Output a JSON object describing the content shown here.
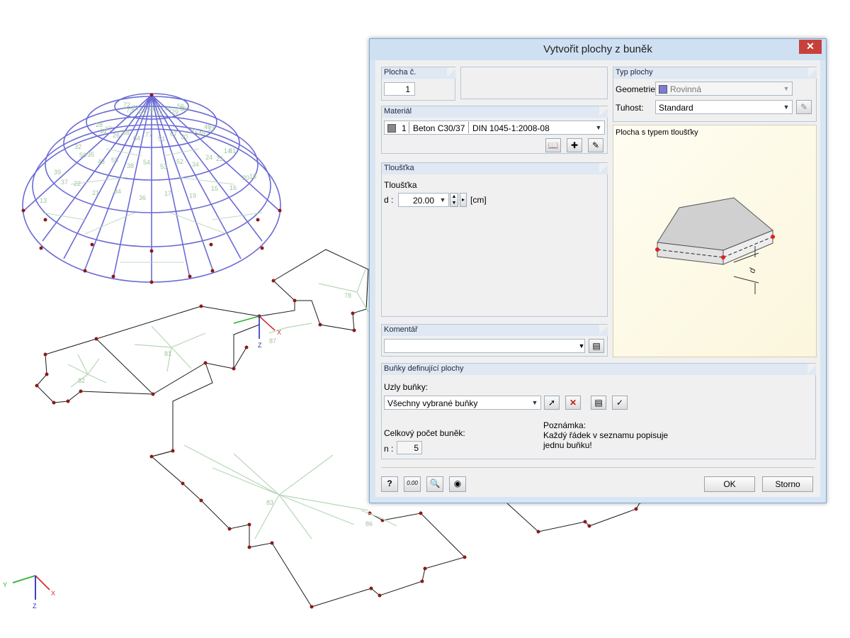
{
  "dialog": {
    "title": "Vytvořit plochy z buněk",
    "close_glyph": "✕",
    "plocha_group": {
      "header": "Plocha č.",
      "value": "1"
    },
    "material_group": {
      "header": "Materiál",
      "number": "1",
      "name": "Beton C30/37",
      "standard": "DIN 1045-1:2008-08",
      "swatch_color": "#888888",
      "icons": [
        "library-icon",
        "new-material-icon",
        "edit-material-icon"
      ]
    },
    "thickness_group": {
      "header": "Tloušťka",
      "sublabel": "Tloušťka",
      "d_label": "d :",
      "d_value": "20.00",
      "unit": "[cm]"
    },
    "comment_group": {
      "header": "Komentář",
      "value": ""
    },
    "surface_type_group": {
      "header": "Typ plochy",
      "geometry_label": "Geometrie:",
      "geometry_value": "Rovinná",
      "geometry_swatch": "#7b7bdc",
      "stiffness_label": "Tuhost:",
      "stiffness_value": "Standard"
    },
    "preview": {
      "caption": "Plocha s typem tloušťky",
      "dim_label": "d"
    },
    "cells_group": {
      "header": "Buňky definující plochy",
      "nodes_label": "Uzly buňky:",
      "nodes_value": "Všechny vybrané buňky",
      "total_label": "Celkový počet buněk:",
      "n_label": "n :",
      "n_value": "5",
      "note_title": "Poznámka:",
      "note_line1": "Každý řádek v seznamu popisuje",
      "note_line2": "jednu buňku!"
    },
    "footer": {
      "ok_label": "OK",
      "cancel_label": "Storno",
      "icons": [
        "help-icon",
        "units-icon",
        "info-icon",
        "view-icon"
      ],
      "units_text": "0.00"
    }
  },
  "viewport": {
    "node_labels": [
      "78",
      "81",
      "82",
      "83",
      "86",
      "87"
    ],
    "dome_numbers": [
      "72",
      "73",
      "71",
      "61",
      "58",
      "45",
      "70",
      "29",
      "56",
      "69",
      "28",
      "44",
      "27",
      "26",
      "68",
      "64",
      "77",
      "51",
      "67",
      "30",
      "31",
      "48",
      "49",
      "33",
      "32",
      "50",
      "35",
      "43",
      "55",
      "38",
      "54",
      "53",
      "52",
      "34",
      "24",
      "23",
      "14",
      "41",
      "39",
      "37",
      "22",
      "21",
      "84",
      "36",
      "17",
      "19",
      "15",
      "16",
      "20",
      "18",
      "13"
    ],
    "axis_labels": {
      "x": "X",
      "y": "Y",
      "z": "Z"
    },
    "colors": {
      "frame": "#6b6bd6",
      "node": "#8b1a1a",
      "cell_label": "#9cc49c",
      "edges": "#1a1a1a"
    }
  }
}
